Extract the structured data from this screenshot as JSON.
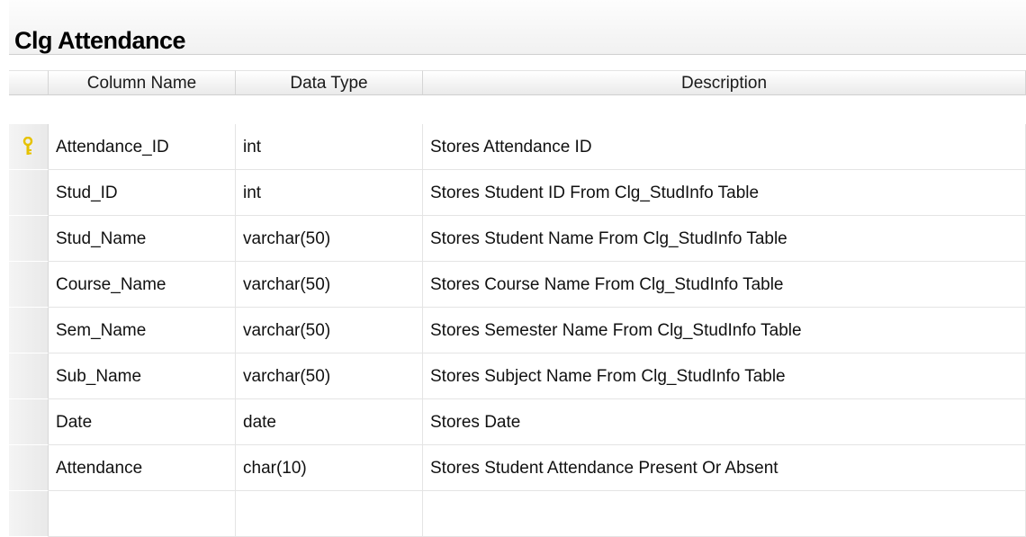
{
  "table_title": "Clg Attendance",
  "columns": {
    "column_name": "Column Name",
    "data_type": "Data Type",
    "description": "Description"
  },
  "rows": [
    {
      "name": "Attendance_ID",
      "type": "int",
      "desc": "Stores Attendance ID",
      "primary_key": true
    },
    {
      "name": "Stud_ID",
      "type": "int",
      "desc": "Stores Student ID From Clg_StudInfo Table",
      "primary_key": false
    },
    {
      "name": "Stud_Name",
      "type": "varchar(50)",
      "desc": "Stores Student Name From Clg_StudInfo Table",
      "primary_key": false
    },
    {
      "name": "Course_Name",
      "type": "varchar(50)",
      "desc": "Stores Course Name From Clg_StudInfo Table",
      "primary_key": false
    },
    {
      "name": "Sem_Name",
      "type": "varchar(50)",
      "desc": "Stores Semester Name From Clg_StudInfo Table",
      "primary_key": false
    },
    {
      "name": "Sub_Name",
      "type": "varchar(50)",
      "desc": "Stores Subject Name From Clg_StudInfo Table",
      "primary_key": false
    },
    {
      "name": "Date",
      "type": "date",
      "desc": "Stores Date",
      "primary_key": false
    },
    {
      "name": "Attendance",
      "type": "char(10)",
      "desc": "Stores Student Attendance Present Or Absent",
      "primary_key": false
    },
    {
      "name": "",
      "type": "",
      "desc": "",
      "primary_key": false
    }
  ],
  "icons": {
    "primary_key": "key-icon"
  },
  "colors": {
    "key_icon": "#e6c200",
    "grid_line": "#e4e4e4",
    "header_bg": "#eaeaea"
  }
}
